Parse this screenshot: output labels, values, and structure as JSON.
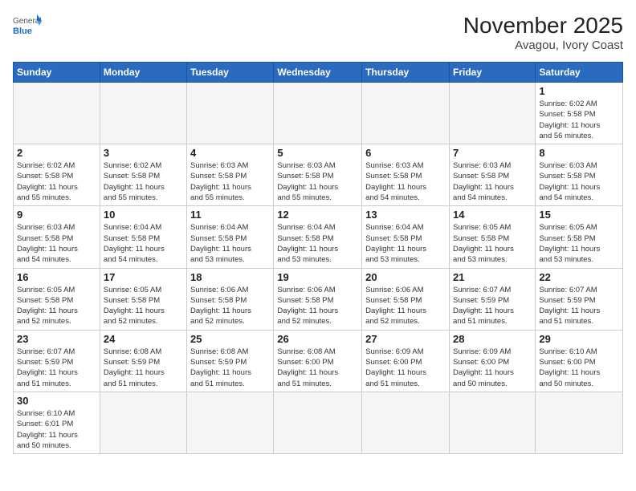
{
  "header": {
    "logo_general": "General",
    "logo_blue": "Blue",
    "month_title": "November 2025",
    "location": "Avagou, Ivory Coast"
  },
  "days_of_week": [
    "Sunday",
    "Monday",
    "Tuesday",
    "Wednesday",
    "Thursday",
    "Friday",
    "Saturday"
  ],
  "weeks": [
    [
      {
        "num": "",
        "info": ""
      },
      {
        "num": "",
        "info": ""
      },
      {
        "num": "",
        "info": ""
      },
      {
        "num": "",
        "info": ""
      },
      {
        "num": "",
        "info": ""
      },
      {
        "num": "",
        "info": ""
      },
      {
        "num": "1",
        "info": "Sunrise: 6:02 AM\nSunset: 5:58 PM\nDaylight: 11 hours\nand 56 minutes."
      }
    ],
    [
      {
        "num": "2",
        "info": "Sunrise: 6:02 AM\nSunset: 5:58 PM\nDaylight: 11 hours\nand 55 minutes."
      },
      {
        "num": "3",
        "info": "Sunrise: 6:02 AM\nSunset: 5:58 PM\nDaylight: 11 hours\nand 55 minutes."
      },
      {
        "num": "4",
        "info": "Sunrise: 6:03 AM\nSunset: 5:58 PM\nDaylight: 11 hours\nand 55 minutes."
      },
      {
        "num": "5",
        "info": "Sunrise: 6:03 AM\nSunset: 5:58 PM\nDaylight: 11 hours\nand 55 minutes."
      },
      {
        "num": "6",
        "info": "Sunrise: 6:03 AM\nSunset: 5:58 PM\nDaylight: 11 hours\nand 54 minutes."
      },
      {
        "num": "7",
        "info": "Sunrise: 6:03 AM\nSunset: 5:58 PM\nDaylight: 11 hours\nand 54 minutes."
      },
      {
        "num": "8",
        "info": "Sunrise: 6:03 AM\nSunset: 5:58 PM\nDaylight: 11 hours\nand 54 minutes."
      }
    ],
    [
      {
        "num": "9",
        "info": "Sunrise: 6:03 AM\nSunset: 5:58 PM\nDaylight: 11 hours\nand 54 minutes."
      },
      {
        "num": "10",
        "info": "Sunrise: 6:04 AM\nSunset: 5:58 PM\nDaylight: 11 hours\nand 54 minutes."
      },
      {
        "num": "11",
        "info": "Sunrise: 6:04 AM\nSunset: 5:58 PM\nDaylight: 11 hours\nand 53 minutes."
      },
      {
        "num": "12",
        "info": "Sunrise: 6:04 AM\nSunset: 5:58 PM\nDaylight: 11 hours\nand 53 minutes."
      },
      {
        "num": "13",
        "info": "Sunrise: 6:04 AM\nSunset: 5:58 PM\nDaylight: 11 hours\nand 53 minutes."
      },
      {
        "num": "14",
        "info": "Sunrise: 6:05 AM\nSunset: 5:58 PM\nDaylight: 11 hours\nand 53 minutes."
      },
      {
        "num": "15",
        "info": "Sunrise: 6:05 AM\nSunset: 5:58 PM\nDaylight: 11 hours\nand 53 minutes."
      }
    ],
    [
      {
        "num": "16",
        "info": "Sunrise: 6:05 AM\nSunset: 5:58 PM\nDaylight: 11 hours\nand 52 minutes."
      },
      {
        "num": "17",
        "info": "Sunrise: 6:05 AM\nSunset: 5:58 PM\nDaylight: 11 hours\nand 52 minutes."
      },
      {
        "num": "18",
        "info": "Sunrise: 6:06 AM\nSunset: 5:58 PM\nDaylight: 11 hours\nand 52 minutes."
      },
      {
        "num": "19",
        "info": "Sunrise: 6:06 AM\nSunset: 5:58 PM\nDaylight: 11 hours\nand 52 minutes."
      },
      {
        "num": "20",
        "info": "Sunrise: 6:06 AM\nSunset: 5:58 PM\nDaylight: 11 hours\nand 52 minutes."
      },
      {
        "num": "21",
        "info": "Sunrise: 6:07 AM\nSunset: 5:59 PM\nDaylight: 11 hours\nand 51 minutes."
      },
      {
        "num": "22",
        "info": "Sunrise: 6:07 AM\nSunset: 5:59 PM\nDaylight: 11 hours\nand 51 minutes."
      }
    ],
    [
      {
        "num": "23",
        "info": "Sunrise: 6:07 AM\nSunset: 5:59 PM\nDaylight: 11 hours\nand 51 minutes."
      },
      {
        "num": "24",
        "info": "Sunrise: 6:08 AM\nSunset: 5:59 PM\nDaylight: 11 hours\nand 51 minutes."
      },
      {
        "num": "25",
        "info": "Sunrise: 6:08 AM\nSunset: 5:59 PM\nDaylight: 11 hours\nand 51 minutes."
      },
      {
        "num": "26",
        "info": "Sunrise: 6:08 AM\nSunset: 6:00 PM\nDaylight: 11 hours\nand 51 minutes."
      },
      {
        "num": "27",
        "info": "Sunrise: 6:09 AM\nSunset: 6:00 PM\nDaylight: 11 hours\nand 51 minutes."
      },
      {
        "num": "28",
        "info": "Sunrise: 6:09 AM\nSunset: 6:00 PM\nDaylight: 11 hours\nand 50 minutes."
      },
      {
        "num": "29",
        "info": "Sunrise: 6:10 AM\nSunset: 6:00 PM\nDaylight: 11 hours\nand 50 minutes."
      }
    ],
    [
      {
        "num": "30",
        "info": "Sunrise: 6:10 AM\nSunset: 6:01 PM\nDaylight: 11 hours\nand 50 minutes."
      },
      {
        "num": "",
        "info": ""
      },
      {
        "num": "",
        "info": ""
      },
      {
        "num": "",
        "info": ""
      },
      {
        "num": "",
        "info": ""
      },
      {
        "num": "",
        "info": ""
      },
      {
        "num": "",
        "info": ""
      }
    ]
  ]
}
